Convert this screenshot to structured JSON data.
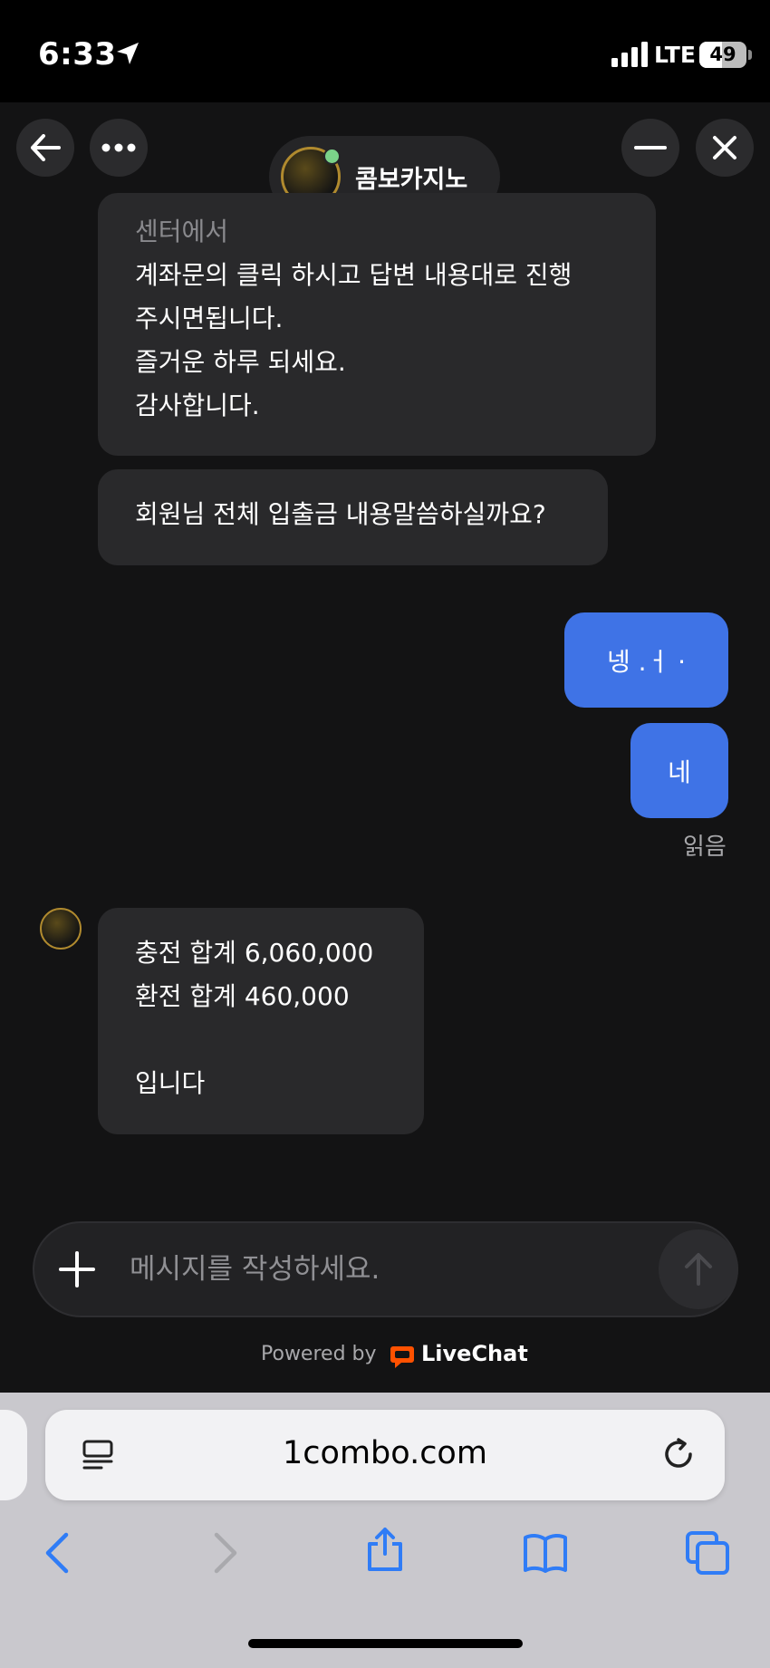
{
  "status_bar": {
    "time": "6:33",
    "network": "LTE",
    "battery": "49",
    "battery_level": 0.49
  },
  "header": {
    "back_icon": "arrow-left-icon",
    "more_icon": "ellipsis-icon",
    "agent_name": "콤보카지노",
    "agent_status": "online",
    "minimize_icon": "minimize-icon",
    "close_icon": "close-icon"
  },
  "messages": [
    {
      "from": "agent",
      "sender": "센터에서",
      "text": "계좌문의 클릭 하시고 답변 내용대로 진행\n주시면됩니다.\n즐거운 하루 되세요.\n감사합니다."
    },
    {
      "from": "agent",
      "text": "회원님 전체 입출금 내용말씀하실까요?"
    },
    {
      "from": "user",
      "text": "넹 .ㅓ ·"
    },
    {
      "from": "user",
      "text": "네"
    },
    {
      "from": "agent",
      "text": "충전 합계 6,060,000\n환전 합계 460,000\n\n입니다"
    }
  ],
  "read_receipt": "읽음",
  "composer": {
    "placeholder": "메시지를 작성하세요.",
    "value": "",
    "add_icon": "plus-icon",
    "send_icon": "arrow-up-icon"
  },
  "footer": {
    "powered_by": "Powered by",
    "brand": "LiveChat",
    "brand_color": "#ff5100"
  },
  "browser": {
    "url": "1combo.com",
    "reader_icon": "reader-icon",
    "reload_icon": "reload-icon",
    "toolbar_icons": [
      "back-icon",
      "forward-icon",
      "share-icon",
      "bookmarks-icon",
      "tabs-icon"
    ]
  },
  "colors": {
    "background": "#131314",
    "incoming_bubble": "#29292b",
    "outgoing_bubble": "#3f73e6",
    "safari_blue": "#2f7cf6"
  }
}
